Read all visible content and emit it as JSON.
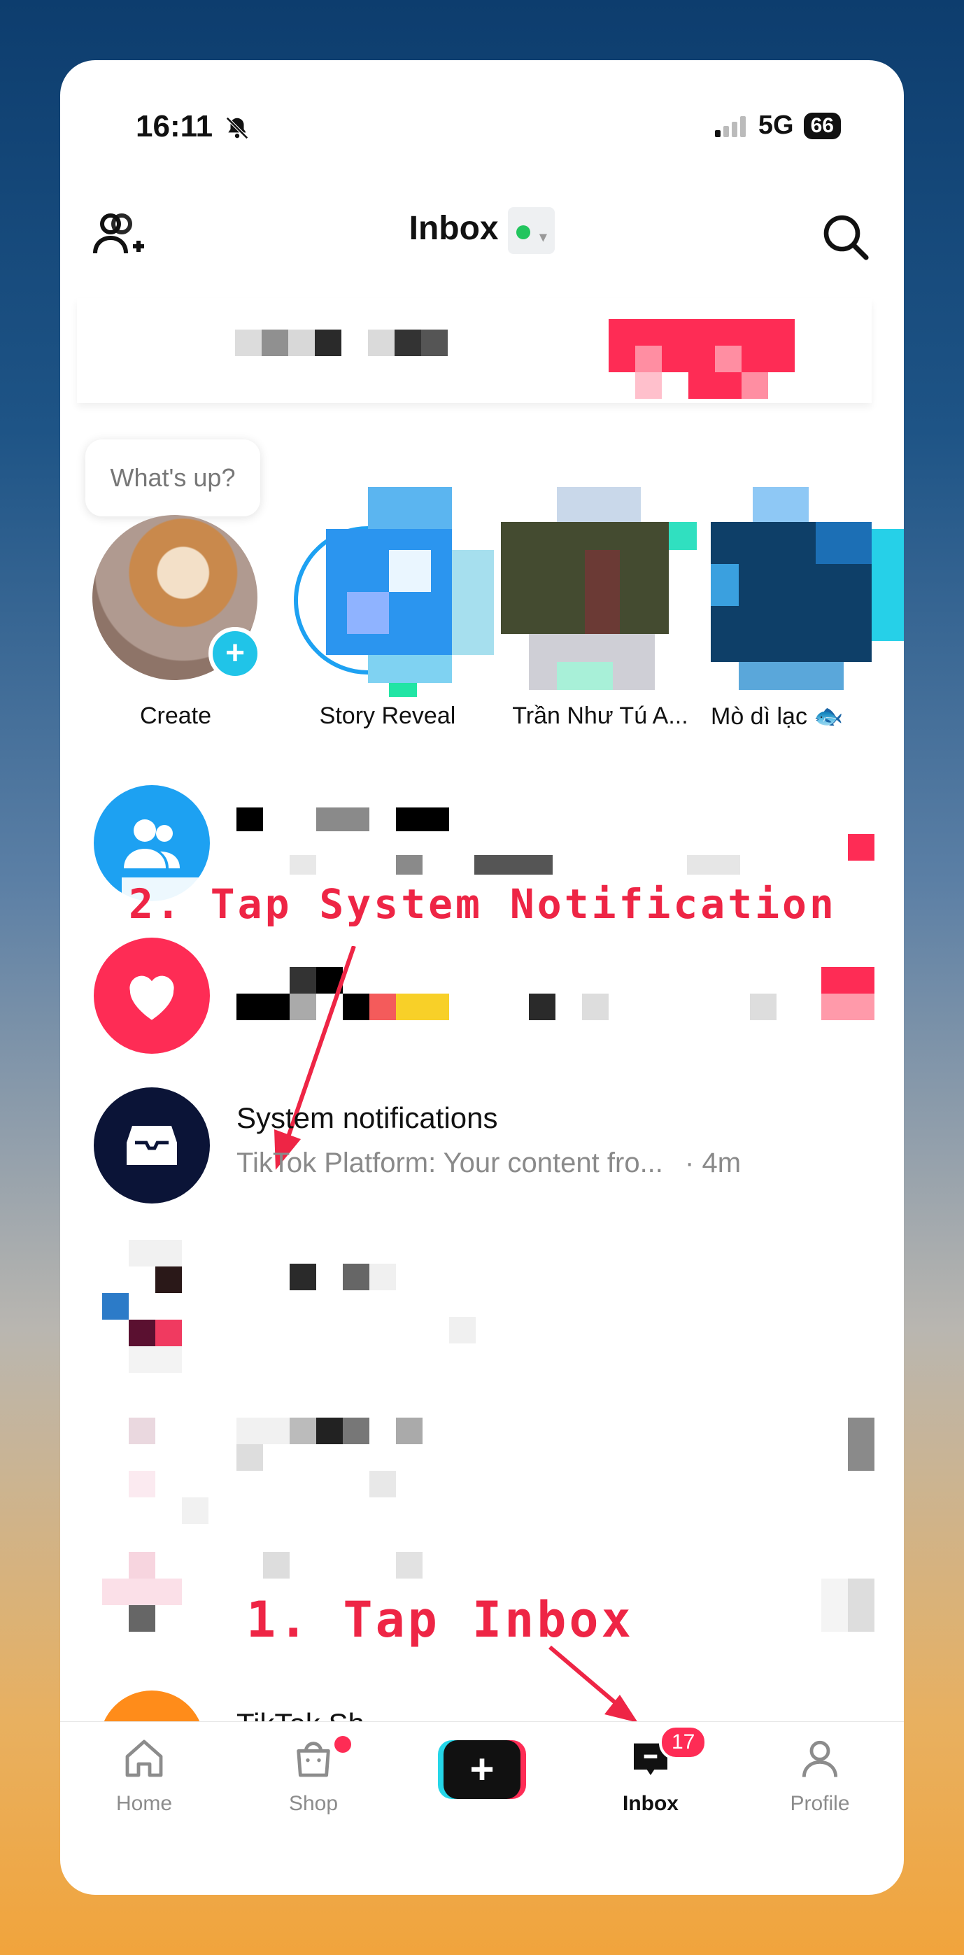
{
  "status_bar": {
    "time": "16:11",
    "network": "5G",
    "battery": "66"
  },
  "header": {
    "title": "Inbox"
  },
  "composer": {
    "bubble_text": "What's up?"
  },
  "stories": [
    {
      "label": "Create"
    },
    {
      "label": "Story Reveal"
    },
    {
      "label": "Trần Như Tú A..."
    },
    {
      "label": "Mò dì lạc 🐟"
    }
  ],
  "system_notifications": {
    "title": "System notifications",
    "preview": "TikTok Platform: Your content fro...",
    "time": "· 4m"
  },
  "partial_row": {
    "title": "TikTok Sh"
  },
  "annotations": {
    "step2": "2. Tap System Notification",
    "step1": "1. Tap Inbox"
  },
  "bottom_nav": {
    "home": "Home",
    "shop": "Shop",
    "inbox": "Inbox",
    "inbox_badge": "17",
    "profile": "Profile"
  },
  "colors": {
    "accent_red": "#fe2c55",
    "online_green": "#22c55e",
    "create_plus": "#20c4e8",
    "friends_blue": "#1da1f2",
    "system_navy": "#0b1437"
  }
}
